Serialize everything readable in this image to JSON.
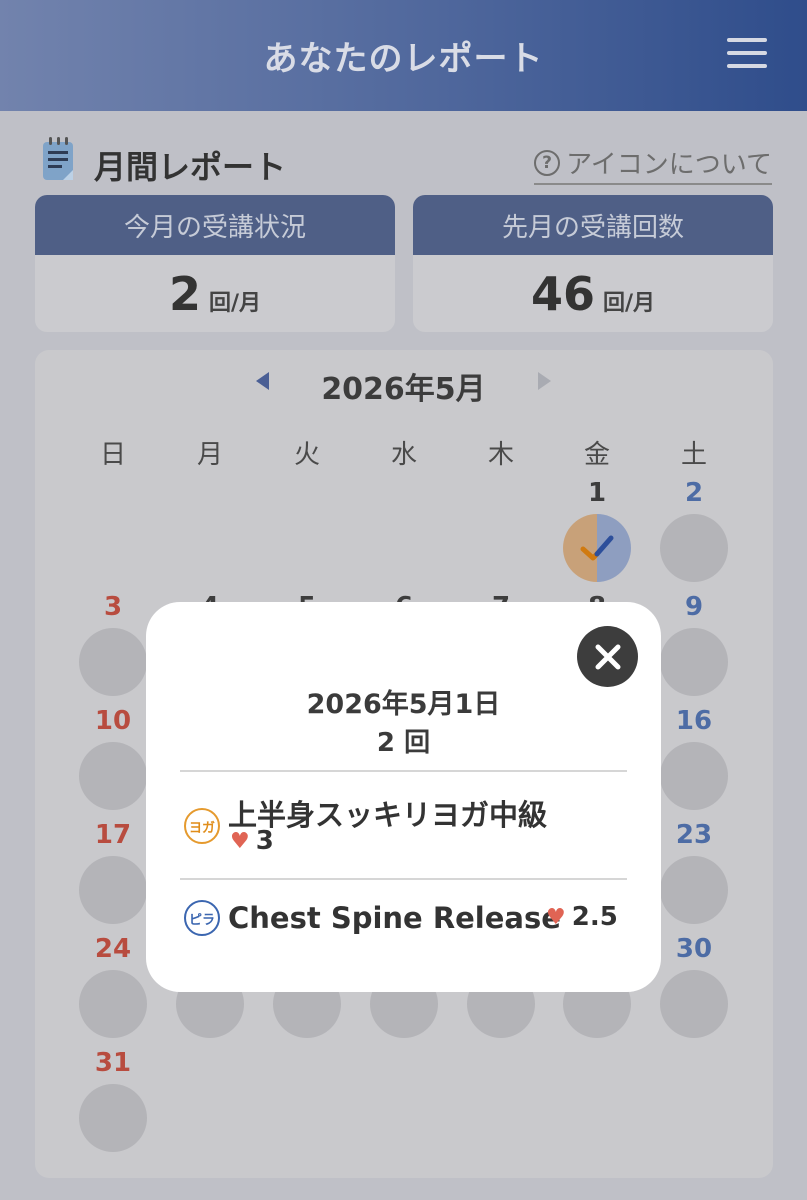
{
  "header": {
    "title": "あなたのレポート",
    "menu_icon": "hamburger-menu-icon"
  },
  "section": {
    "title": "月間レポート",
    "help_link": "アイコンについて",
    "help_icon": "question-circle-icon"
  },
  "stats": [
    {
      "label": "今月の受講状況",
      "value": "2",
      "unit": "回/月"
    },
    {
      "label": "先月の受講回数",
      "value": "46",
      "unit": "回/月"
    }
  ],
  "calendar": {
    "month_label": "2026年5月",
    "weekdays": [
      "日",
      "月",
      "火",
      "水",
      "木",
      "金",
      "土"
    ],
    "visible_days": [
      "1",
      "2",
      "3",
      "4",
      "5",
      "6",
      "7",
      "8",
      "9",
      "10",
      "16",
      "17",
      "23",
      "24",
      "30",
      "31"
    ],
    "completed_day": "1"
  },
  "popup": {
    "date": "2026年5月1日",
    "count": "2 回",
    "lessons": [
      {
        "badge": "ヨガ",
        "name": "上半身スッキリヨガ中級",
        "score": "3"
      },
      {
        "badge": "ピラ",
        "name": "Chest Spine Release",
        "score": "2.5"
      }
    ]
  },
  "colors": {
    "header_start": "#7283ad",
    "header_end": "#2f4d8b",
    "sunday": "#b84c3f",
    "saturday": "#4d6ca5",
    "yoga": "#e59a2e",
    "pilates": "#3b66b0",
    "heart": "#e06454"
  }
}
